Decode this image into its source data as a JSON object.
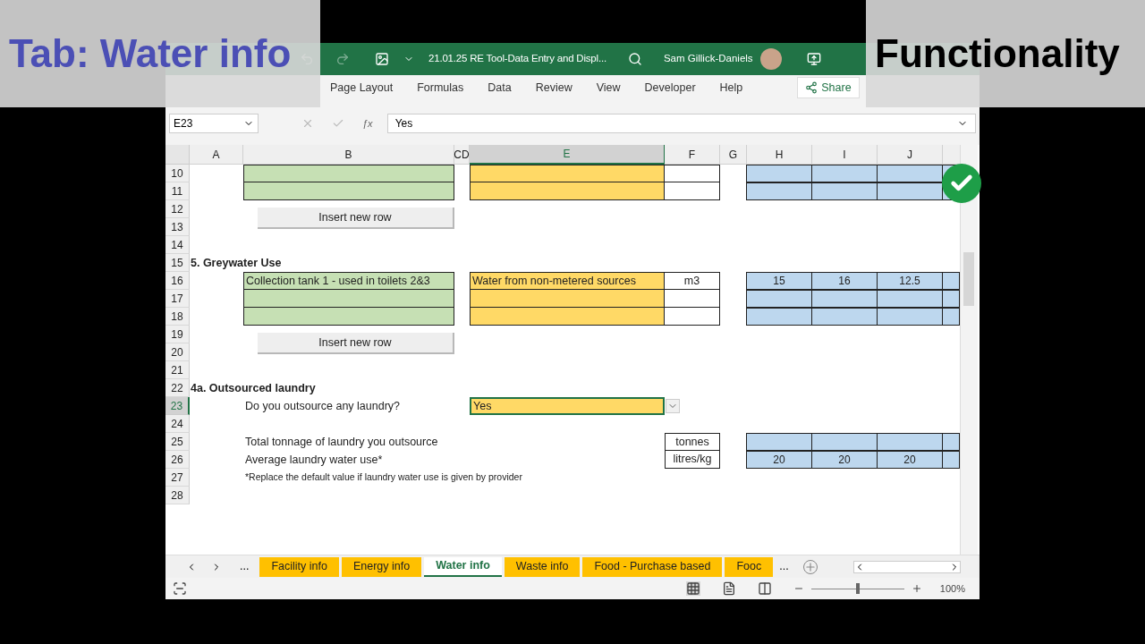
{
  "overlay": {
    "left": "Tab: Water info",
    "right": "Functionality"
  },
  "title_bar": {
    "title": "21.01.25 RE Tool-Data Entry and Displ...",
    "user": "Sam Gillick-Daniels"
  },
  "ribbon_tabs": [
    {
      "label": "Page Layout"
    },
    {
      "label": "Formulas"
    },
    {
      "label": "Data"
    },
    {
      "label": "Review"
    },
    {
      "label": "View"
    },
    {
      "label": "Developer"
    },
    {
      "label": "Help"
    }
  ],
  "share": "Share",
  "formula_bar": {
    "name_box": "E23",
    "function_label": "ƒx",
    "value": "Yes"
  },
  "columns": [
    {
      "label": "A",
      "selected": false
    },
    {
      "label": "B",
      "selected": false
    },
    {
      "label": "CD",
      "selected": false
    },
    {
      "label": "E",
      "selected": true
    },
    {
      "label": "F",
      "selected": false
    },
    {
      "label": "G",
      "selected": false
    },
    {
      "label": "H",
      "selected": false
    },
    {
      "label": "I",
      "selected": false
    },
    {
      "label": "J",
      "selected": false
    }
  ],
  "row_numbers": [
    {
      "label": "10",
      "selected": false
    },
    {
      "label": "11",
      "selected": false
    },
    {
      "label": "12",
      "selected": false
    },
    {
      "label": "13",
      "selected": false
    },
    {
      "label": "14",
      "selected": false
    },
    {
      "label": "15",
      "selected": false
    },
    {
      "label": "16",
      "selected": false
    },
    {
      "label": "17",
      "selected": false
    },
    {
      "label": "18",
      "selected": false
    },
    {
      "label": "19",
      "selected": false
    },
    {
      "label": "20",
      "selected": false
    },
    {
      "label": "21",
      "selected": false
    },
    {
      "label": "22",
      "selected": false
    },
    {
      "label": "23",
      "selected": true
    },
    {
      "label": "24",
      "selected": false
    },
    {
      "label": "25",
      "selected": false
    },
    {
      "label": "26",
      "selected": false
    },
    {
      "label": "27",
      "selected": false
    },
    {
      "label": "28",
      "selected": false
    }
  ],
  "sheet": {
    "buttons": [
      "Insert new row",
      "Insert new row"
    ],
    "greywater": {
      "heading": "5. Greywater Use",
      "source": "Collection tank 1 - used in toilets 2&3",
      "type": "Water from non-metered sources",
      "unit": "m3",
      "values": [
        "15",
        "16",
        "12.5"
      ]
    },
    "laundry": {
      "heading": "4a. Outsourced laundry",
      "question": "Do you outsource any laundry?",
      "answer": "Yes",
      "tonnage_label": "Total tonnage of laundry you outsource",
      "tonnage_unit": "tonnes",
      "water_use_label": "Average laundry water use*",
      "water_use_unit": "litres/kg",
      "water_use_values": [
        "20",
        "20",
        "20"
      ],
      "note": "*Replace the default value if laundry water use is given by provider"
    }
  },
  "sheet_nav": {
    "more_left": "...",
    "more_right": "..."
  },
  "sheet_tabs": [
    {
      "label": "Facility info",
      "selected": false
    },
    {
      "label": "Energy info",
      "selected": false
    },
    {
      "label": "Water info",
      "selected": true
    },
    {
      "label": "Waste info",
      "selected": false
    },
    {
      "label": "Food - Purchase based",
      "selected": false
    },
    {
      "label": "Fooc",
      "selected": false
    }
  ],
  "zoom_slider": {
    "level": 0.5
  },
  "zoom": "100%"
}
